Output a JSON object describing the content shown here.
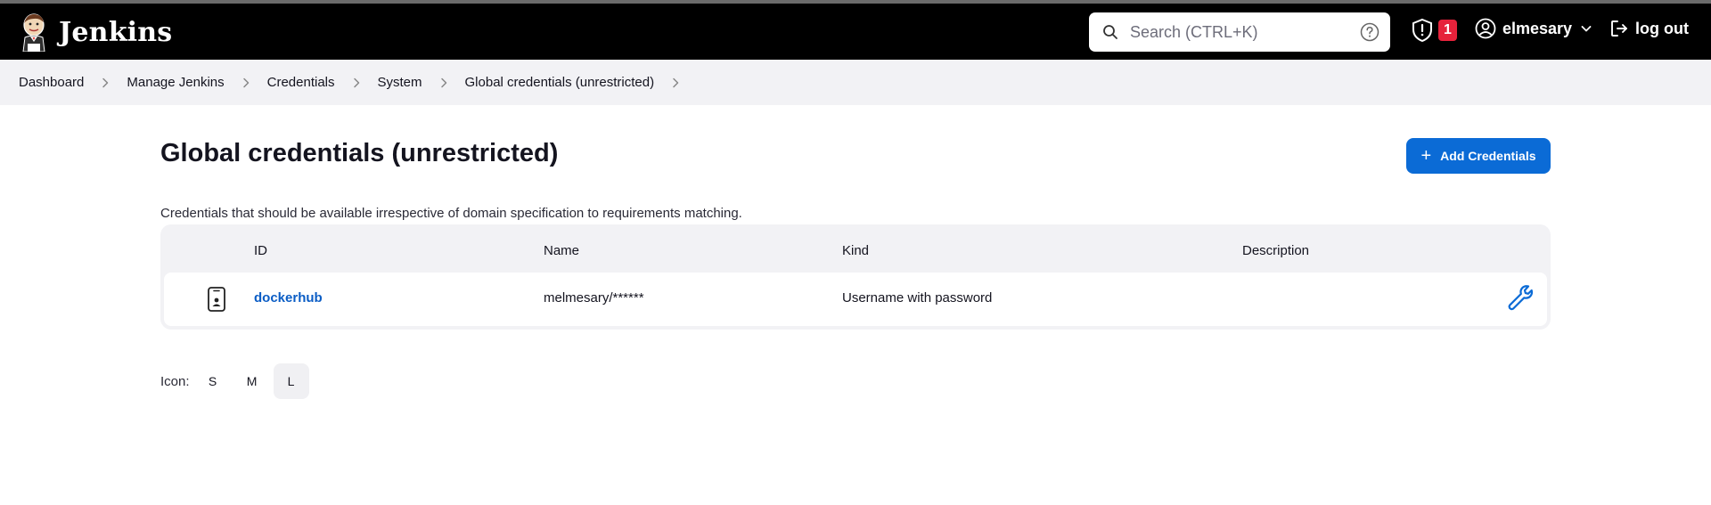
{
  "header": {
    "brand_name": "Jenkins",
    "search": {
      "placeholder": "Search (CTRL+K)",
      "value": ""
    },
    "security_count": "1",
    "user_name": "elmesary",
    "logout_label": "log out"
  },
  "breadcrumb": [
    "Dashboard",
    "Manage Jenkins",
    "Credentials",
    "System",
    "Global credentials (unrestricted)"
  ],
  "page": {
    "title": "Global credentials (unrestricted)",
    "add_button_label": "Add Credentials",
    "description": "Credentials that should be available irrespective of domain specification to requirements matching."
  },
  "table": {
    "headers": {
      "id": "ID",
      "name": "Name",
      "kind": "Kind",
      "description": "Description"
    },
    "rows": [
      {
        "id": "dockerhub",
        "name": "melmesary/******",
        "kind": "Username with password",
        "description": ""
      }
    ]
  },
  "icon_size": {
    "label": "Icon:",
    "options": [
      "S",
      "M",
      "L"
    ],
    "selected": "L"
  },
  "colors": {
    "accent": "#0b6bd6",
    "header_bg": "#000000",
    "badge": "#e6223b",
    "breadcrumb_bg": "#f2f2f5"
  },
  "icons": [
    "jenkins-logo",
    "search-icon",
    "help-icon",
    "shield-icon",
    "user-icon",
    "chevron-down-icon",
    "logout-icon",
    "chevron-right-icon",
    "plus-icon",
    "phone-icon",
    "wrench-icon"
  ]
}
